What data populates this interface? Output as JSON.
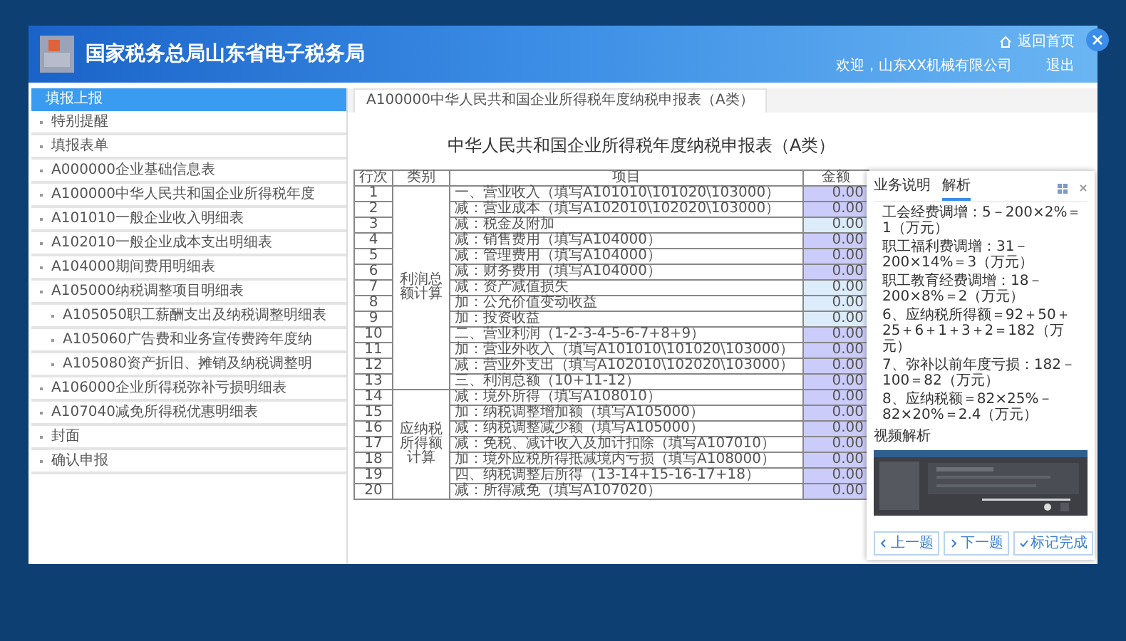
{
  "header": {
    "site_title": "国家税务总局山东省电子税务局",
    "home_link": "返回首页",
    "welcome": "欢迎，山东XX机械有限公司",
    "logout": "退出"
  },
  "sidebar": {
    "title": "填报上报",
    "items": [
      {
        "label": "特别提醒"
      },
      {
        "label": "填报表单"
      },
      {
        "label": "A000000企业基础信息表"
      },
      {
        "label": "A100000中华人民共和国企业所得税年度"
      },
      {
        "label": "A101010一般企业收入明细表"
      },
      {
        "label": "A102010一般企业成本支出明细表"
      },
      {
        "label": "A104000期间费用明细表"
      },
      {
        "label": "A105000纳税调整项目明细表",
        "children": [
          {
            "label": "A105050职工薪酬支出及纳税调整明细表"
          },
          {
            "label": "A105060广告费和业务宣传费跨年度纳"
          },
          {
            "label": "A105080资产折旧、摊销及纳税调整明"
          }
        ]
      },
      {
        "label": "A106000企业所得税弥补亏损明细表"
      },
      {
        "label": "A107040减免所得税优惠明细表"
      },
      {
        "label": "封面"
      },
      {
        "label": "确认申报"
      }
    ]
  },
  "tabs": [
    {
      "label": "A100000中华人民共和国企业所得税年度纳税申报表（A类）",
      "selected": true
    }
  ],
  "form": {
    "title": "中华人民共和国企业所得税年度纳税申报表（A类）",
    "columns": [
      "行次",
      "类别",
      "项目",
      "金额"
    ],
    "groups": [
      {
        "category": "利润总额计算",
        "rows": [
          {
            "line": "1",
            "item": "一、营业收入（填写A101010\\101020\\103000）",
            "amount": "0.00",
            "kind": "calc"
          },
          {
            "line": "2",
            "item": "减：营业成本（填写A102010\\102020\\103000）",
            "amount": "0.00",
            "kind": "calc"
          },
          {
            "line": "3",
            "item": "减：税金及附加",
            "amount": "0.00",
            "kind": "input"
          },
          {
            "line": "4",
            "item": "减：销售费用（填写A104000）",
            "amount": "0.00",
            "kind": "calc"
          },
          {
            "line": "5",
            "item": "减：管理费用（填写A104000）",
            "amount": "0.00",
            "kind": "calc"
          },
          {
            "line": "6",
            "item": "减：财务费用（填写A104000）",
            "amount": "0.00",
            "kind": "calc"
          },
          {
            "line": "7",
            "item": "减：资产减值损失",
            "amount": "0.00",
            "kind": "input"
          },
          {
            "line": "8",
            "item": "加：公允价值变动收益",
            "amount": "0.00",
            "kind": "input"
          },
          {
            "line": "9",
            "item": "加：投资收益",
            "amount": "0.00",
            "kind": "input"
          },
          {
            "line": "10",
            "item": "二、营业利润（1-2-3-4-5-6-7+8+9）",
            "amount": "0.00",
            "kind": "calc"
          },
          {
            "line": "11",
            "item": "加：营业外收入（填写A101010\\101020\\103000）",
            "amount": "0.00",
            "kind": "calc"
          },
          {
            "line": "12",
            "item": "减：营业外支出（填写A102010\\102020\\103000）",
            "amount": "0.00",
            "kind": "calc"
          },
          {
            "line": "13",
            "item": "三、利润总额（10+11-12）",
            "amount": "0.00",
            "kind": "calc"
          }
        ]
      },
      {
        "category": "应纳税所得额计算",
        "rows": [
          {
            "line": "14",
            "item": "减：境外所得（填写A108010）",
            "amount": "0.00",
            "kind": "calc"
          },
          {
            "line": "15",
            "item": "加：纳税调整增加额（填写A105000）",
            "amount": "0.00",
            "kind": "calc"
          },
          {
            "line": "16",
            "item": "减：纳税调整减少额（填写A105000）",
            "amount": "0.00",
            "kind": "calc"
          },
          {
            "line": "17",
            "item": "减：免税、减计收入及加计扣除（填写A107010）",
            "amount": "0.00",
            "kind": "calc"
          },
          {
            "line": "18",
            "item": "加：境外应税所得抵减境内亏损（填写A108000）",
            "amount": "0.00",
            "kind": "calc"
          },
          {
            "line": "19",
            "item": "四、纳税调整后所得（13-14+15-16-17+18）",
            "amount": "0.00",
            "kind": "calc"
          },
          {
            "line": "20",
            "item": "减：所得减免（填写A107020）",
            "amount": "0.00",
            "kind": "calc"
          }
        ]
      }
    ]
  },
  "help_panel": {
    "tabs": [
      {
        "label": "业务说明",
        "selected": false
      },
      {
        "label": "解析",
        "selected": true
      }
    ],
    "lines": [
      "工会经费调增：5－200×2%＝1（万元）",
      "职工福利费调增：31－200×14%＝3（万元）",
      "职工教育经费调增：18－200×8%＝2（万元）",
      "6、应纳税所得额＝92＋50＋25＋6＋1＋3＋2＝182（万元）",
      "7、弥补以前年度亏损：182－100＝82（万元）",
      "8、应纳税额＝82×25%－82×20%＝2.4（万元）"
    ],
    "video_label": "视频解析",
    "video": {
      "kind": "picture"
    },
    "buttons": [
      {
        "label": "上一题",
        "kind": "prev"
      },
      {
        "label": "下一题",
        "kind": "next"
      },
      {
        "label": "标记完成",
        "kind": "done"
      }
    ]
  }
}
